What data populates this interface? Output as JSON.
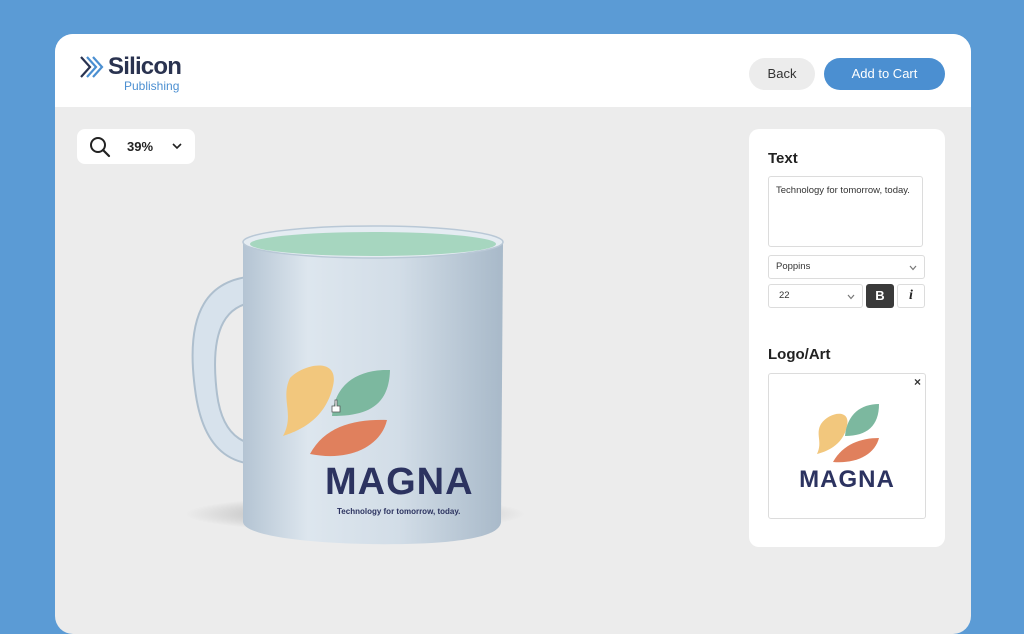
{
  "brand": {
    "name": "Silicon",
    "sub": "Publishing"
  },
  "header": {
    "back_label": "Back",
    "cart_label": "Add to Cart"
  },
  "zoom": {
    "value": "39%",
    "icon": "magnifier-icon"
  },
  "product": {
    "print_title": "MAGNA",
    "print_tagline": "Technology for tomorrow, today."
  },
  "panel": {
    "text_heading": "Text",
    "text_value": "Technology for tomorrow, today.",
    "font": "Poppins",
    "size": "22",
    "bold_label": "B",
    "italic_label": "i",
    "logo_heading": "Logo/Art",
    "remove_label": "×",
    "logo_word": "MAGNA"
  },
  "colors": {
    "background": "#5b9bd5",
    "accent": "#4b8fd1",
    "mug_body": "#cfdbe6",
    "mug_interior": "#a6d6bf",
    "leaf_yellow": "#f2c77d",
    "leaf_green": "#7cb89f",
    "leaf_orange": "#e0805d",
    "logo_text": "#2c3360"
  }
}
